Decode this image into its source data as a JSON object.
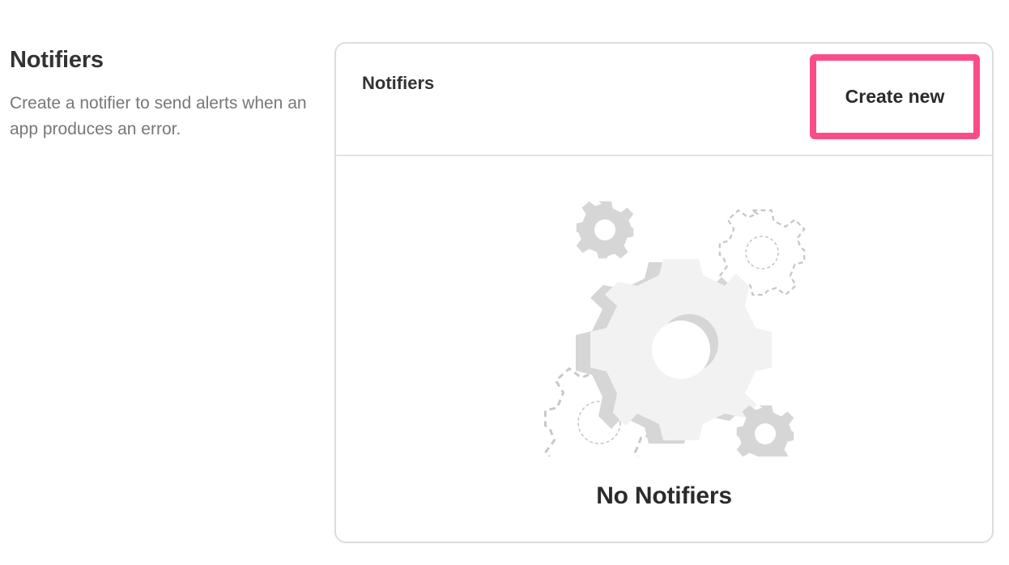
{
  "section": {
    "title": "Notifiers",
    "description": "Create a notifier to send alerts when an app produces an error."
  },
  "card": {
    "title": "Notifiers",
    "create_button_label": "Create new",
    "empty_state_text": "No Notifiers",
    "illustration_icon": "gears-icon"
  },
  "colors": {
    "highlight_border": "#fb4c8a",
    "gear_fill": "#f2f2f2",
    "gear_shadow": "#d6d6d6",
    "dashed_gear_stroke": "#c8c8c8"
  }
}
